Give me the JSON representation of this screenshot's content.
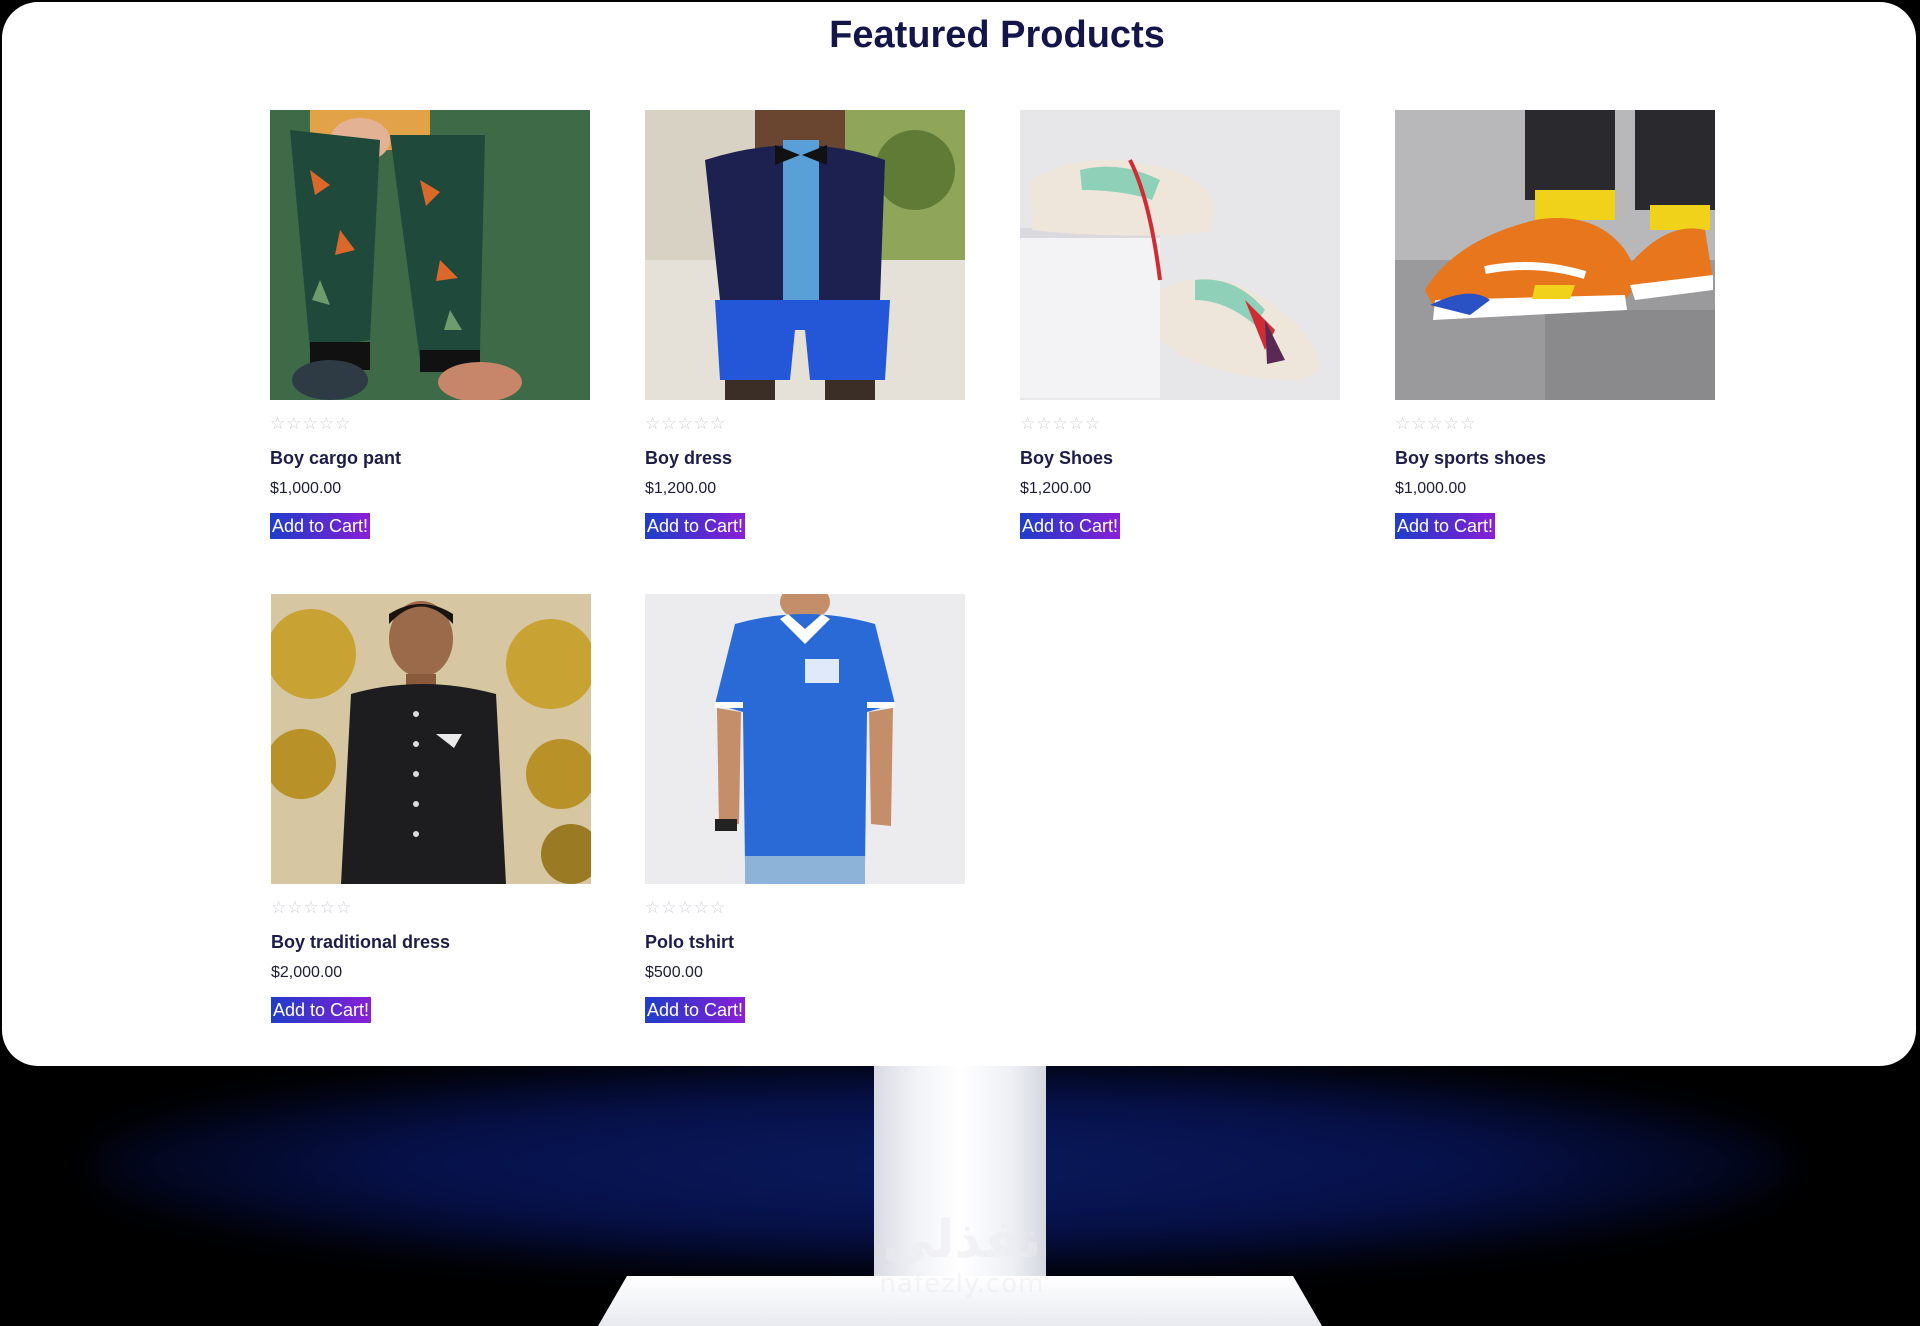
{
  "page_title": "Featured Products",
  "watermark": {
    "main": "نفذلي",
    "sub": "nafezly.com"
  },
  "products": [
    {
      "name": "Boy cargo pant",
      "price": "$1,000.00",
      "rating": "☆☆☆☆☆",
      "cart_label": "Add to Cart!",
      "image_icon": "cargo-pant-photo"
    },
    {
      "name": "Boy dress",
      "price": "$1,200.00",
      "rating": "☆☆☆☆☆",
      "cart_label": "Add to Cart!",
      "image_icon": "boy-dress-photo"
    },
    {
      "name": "Boy Shoes",
      "price": "$1,200.00",
      "rating": "☆☆☆☆☆",
      "cart_label": "Add to Cart!",
      "image_icon": "shoes-photo"
    },
    {
      "name": "Boy sports shoes",
      "price": "$1,000.00",
      "rating": "☆☆☆☆☆",
      "cart_label": "Add to Cart!",
      "image_icon": "sports-shoes-photo"
    },
    {
      "name": "Boy traditional dress",
      "price": "$2,000.00",
      "rating": "☆☆☆☆☆",
      "cart_label": "Add to Cart!",
      "image_icon": "traditional-dress-photo"
    },
    {
      "name": "Polo tshirt",
      "price": "$500.00",
      "rating": "☆☆☆☆☆",
      "cart_label": "Add to Cart!",
      "image_icon": "polo-tshirt-photo"
    }
  ],
  "colors": {
    "title": "#14164a",
    "button_start": "#1f3ec9",
    "button_end": "#8a1fd6",
    "stars": "#cfcfd6"
  }
}
